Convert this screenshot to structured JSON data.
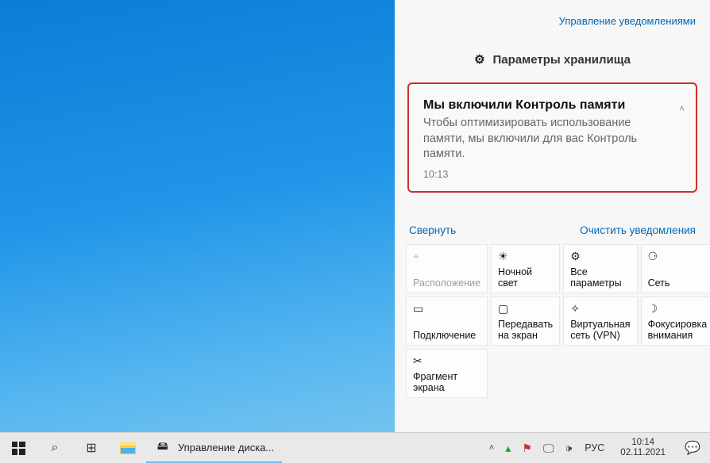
{
  "action_center": {
    "manage_link": "Управление уведомлениями",
    "group_header": "Параметры хранилища",
    "notification": {
      "title": "Мы включили Контроль памяти",
      "body": "Чтобы оптимизировать использование памяти, мы включили для вас Контроль памяти.",
      "time": "10:13"
    },
    "collapse": "Свернуть",
    "clear": "Очистить уведомления",
    "tiles": [
      {
        "label": "Расположение",
        "icon": "⌖",
        "disabled": true
      },
      {
        "label": "Ночной свет",
        "icon": "☀"
      },
      {
        "label": "Все параметры",
        "icon": "⚙"
      },
      {
        "label": "Сеть",
        "icon": "⚆"
      },
      {
        "label": "Подключение",
        "icon": "▭"
      },
      {
        "label": "Передавать на экран",
        "icon": "▢"
      },
      {
        "label": "Виртуальная сеть (VPN)",
        "icon": "✧"
      },
      {
        "label": "Фокусировка внимания",
        "icon": "☽"
      },
      {
        "label": "Фрагмент экрана",
        "icon": "✂"
      }
    ]
  },
  "taskbar": {
    "task_label": "Управление диска...",
    "lang": "РУС",
    "time": "10:14",
    "date": "02.11.2021"
  }
}
